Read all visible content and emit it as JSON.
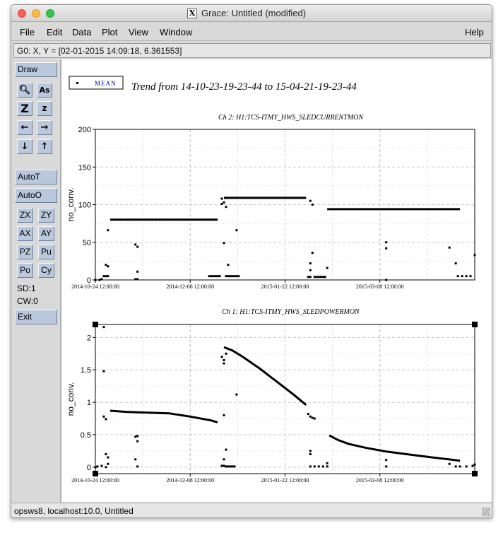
{
  "window": {
    "title": "Grace: Untitled (modified)"
  },
  "menu": {
    "file": "File",
    "edit": "Edit",
    "data": "Data",
    "plot": "Plot",
    "view": "View",
    "window": "Window",
    "help": "Help"
  },
  "locator": "G0: X, Y = [02-01-2015 14:09:18, 6.361553]",
  "toolbox": {
    "draw": "Draw",
    "autot": "AutoT",
    "autoo": "AutoO",
    "zx": "ZX",
    "zy": "ZY",
    "ax": "AX",
    "ay": "AY",
    "pz": "PZ",
    "pu": "Pu",
    "po": "Po",
    "cy": "Cy",
    "sd": "SD:1",
    "cw": "CW:0",
    "exit": "Exit"
  },
  "status": "opsws8, localhost:10.0, Untitled",
  "legend": {
    "label": "MEAN"
  },
  "trend_title": "Trend from 14-10-23-19-23-44 to 15-04-21-19-23-44",
  "chart_data": [
    {
      "type": "scatter",
      "title": "Ch 2: H1:TCS-ITMY_HWS_SLEDCURRENTMON",
      "ylabel": "no_conv.",
      "xlabel": "",
      "ylim": [
        0,
        200
      ],
      "yticks": [
        "0",
        "50",
        "100",
        "150",
        "200"
      ],
      "xtick_labels": [
        "2014-10-24 12:00:00",
        "2014-12-08 12:00:00",
        "2015-01-22 12:00:00",
        "2015-03-08 12:00:00"
      ],
      "xlim_days": [
        0,
        180
      ],
      "grid": true,
      "series": [
        {
          "name": "MEAN",
          "segments": [
            [
              [
                7,
                80
              ],
              [
                58,
                80
              ]
            ],
            [
              [
                61,
                109
              ],
              [
                100,
                109
              ]
            ],
            [
              [
                110,
                94
              ],
              [
                173,
                94
              ]
            ]
          ],
          "points": [
            [
              0,
              0
            ],
            [
              2,
              0
            ],
            [
              3,
              1
            ],
            [
              4,
              5
            ],
            [
              5,
              5
            ],
            [
              6,
              5
            ],
            [
              5,
              20
            ],
            [
              6,
              18
            ],
            [
              6,
              66
            ],
            [
              19,
              1
            ],
            [
              20,
              1
            ],
            [
              20,
              11
            ],
            [
              19,
              47
            ],
            [
              20,
              44
            ],
            [
              54,
              5
            ],
            [
              55,
              5
            ],
            [
              56,
              5
            ],
            [
              57,
              5
            ],
            [
              58,
              5
            ],
            [
              59,
              5
            ],
            [
              60,
              101
            ],
            [
              60,
              108
            ],
            [
              61,
              103
            ],
            [
              62,
              109
            ],
            [
              62,
              97
            ],
            [
              61,
              49
            ],
            [
              63,
              20
            ],
            [
              62,
              5
            ],
            [
              63,
              5
            ],
            [
              64,
              5
            ],
            [
              65,
              5
            ],
            [
              66,
              5
            ],
            [
              67,
              5
            ],
            [
              68,
              5
            ],
            [
              67,
              66
            ],
            [
              102,
              105
            ],
            [
              103,
              100
            ],
            [
              101,
              4
            ],
            [
              102,
              4
            ],
            [
              104,
              4
            ],
            [
              105,
              4
            ],
            [
              106,
              4
            ],
            [
              107,
              4
            ],
            [
              108,
              4
            ],
            [
              109,
              4
            ],
            [
              103,
              36
            ],
            [
              102,
              22
            ],
            [
              102,
              13
            ],
            [
              110,
              16
            ],
            [
              138,
              0
            ],
            [
              138,
              50
            ],
            [
              138,
              42
            ],
            [
              168,
              43
            ],
            [
              171,
              22
            ],
            [
              172,
              5
            ],
            [
              174,
              5
            ],
            [
              176,
              5
            ],
            [
              178,
              5
            ],
            [
              180,
              33
            ]
          ]
        }
      ]
    },
    {
      "type": "scatter",
      "title": "Ch 1: H1:TCS-ITMY_HWS_SLEDPOWERMON",
      "ylabel": "no_conv.",
      "xlabel": "",
      "ylim": [
        -0.1,
        2.2
      ],
      "yticks": [
        "0",
        "0.5",
        "1",
        "1.5",
        "2"
      ],
      "xtick_labels": [
        "2014-10-24 12:00:00",
        "2014-12-08 12:00:00",
        "2015-01-22 12:00:00",
        "2015-03-08 12:00:00"
      ],
      "xlim_days": [
        0,
        180
      ],
      "grid": true,
      "series": [
        {
          "name": "MEAN",
          "curve": [
            [
              7,
              0.87
            ],
            [
              15,
              0.85
            ],
            [
              25,
              0.84
            ],
            [
              35,
              0.83
            ],
            [
              45,
              0.78
            ],
            [
              55,
              0.72
            ],
            [
              58,
              0.69
            ],
            [
              61,
              1.85
            ],
            [
              65,
              1.8
            ],
            [
              70,
              1.7
            ],
            [
              78,
              1.52
            ],
            [
              86,
              1.32
            ],
            [
              94,
              1.12
            ],
            [
              100,
              0.96
            ],
            [
              111,
              0.49
            ],
            [
              115,
              0.42
            ],
            [
              120,
              0.36
            ],
            [
              128,
              0.3
            ],
            [
              138,
              0.24
            ],
            [
              150,
              0.19
            ],
            [
              160,
              0.15
            ],
            [
              173,
              0.1
            ]
          ],
          "points": [
            [
              0,
              0
            ],
            [
              1,
              0.01
            ],
            [
              3,
              0.02
            ],
            [
              5,
              0
            ],
            [
              4,
              2.16
            ],
            [
              4,
              1.48
            ],
            [
              4,
              0.78
            ],
            [
              5,
              0.74
            ],
            [
              5,
              0.2
            ],
            [
              6,
              0.15
            ],
            [
              6,
              0.05
            ],
            [
              19,
              0.47
            ],
            [
              20,
              0.48
            ],
            [
              20,
              0.4
            ],
            [
              19,
              0.12
            ],
            [
              20,
              0.01
            ],
            [
              60,
              1.7
            ],
            [
              61,
              1.65
            ],
            [
              61,
              1.6
            ],
            [
              62,
              1.75
            ],
            [
              60,
              0.02
            ],
            [
              61,
              0.02
            ],
            [
              62,
              0.01
            ],
            [
              63,
              0.01
            ],
            [
              64,
              0.01
            ],
            [
              65,
              0.01
            ],
            [
              66,
              0.01
            ],
            [
              61,
              0.8
            ],
            [
              62,
              0.27
            ],
            [
              61,
              0.12
            ],
            [
              67,
              1.12
            ],
            [
              101,
              0.82
            ],
            [
              102,
              0.78
            ],
            [
              103,
              0.76
            ],
            [
              104,
              0.75
            ],
            [
              102,
              0.25
            ],
            [
              102,
              0.2
            ],
            [
              102,
              0.01
            ],
            [
              104,
              0.01
            ],
            [
              106,
              0.01
            ],
            [
              108,
              0.01
            ],
            [
              110,
              0.01
            ],
            [
              110,
              0.06
            ],
            [
              138,
              0.11
            ],
            [
              138,
              0.01
            ],
            [
              168,
              0.05
            ],
            [
              171,
              0.01
            ],
            [
              173,
              0.01
            ],
            [
              176,
              0.01
            ],
            [
              179,
              0.02
            ],
            [
              180,
              0.04
            ]
          ]
        }
      ]
    }
  ]
}
